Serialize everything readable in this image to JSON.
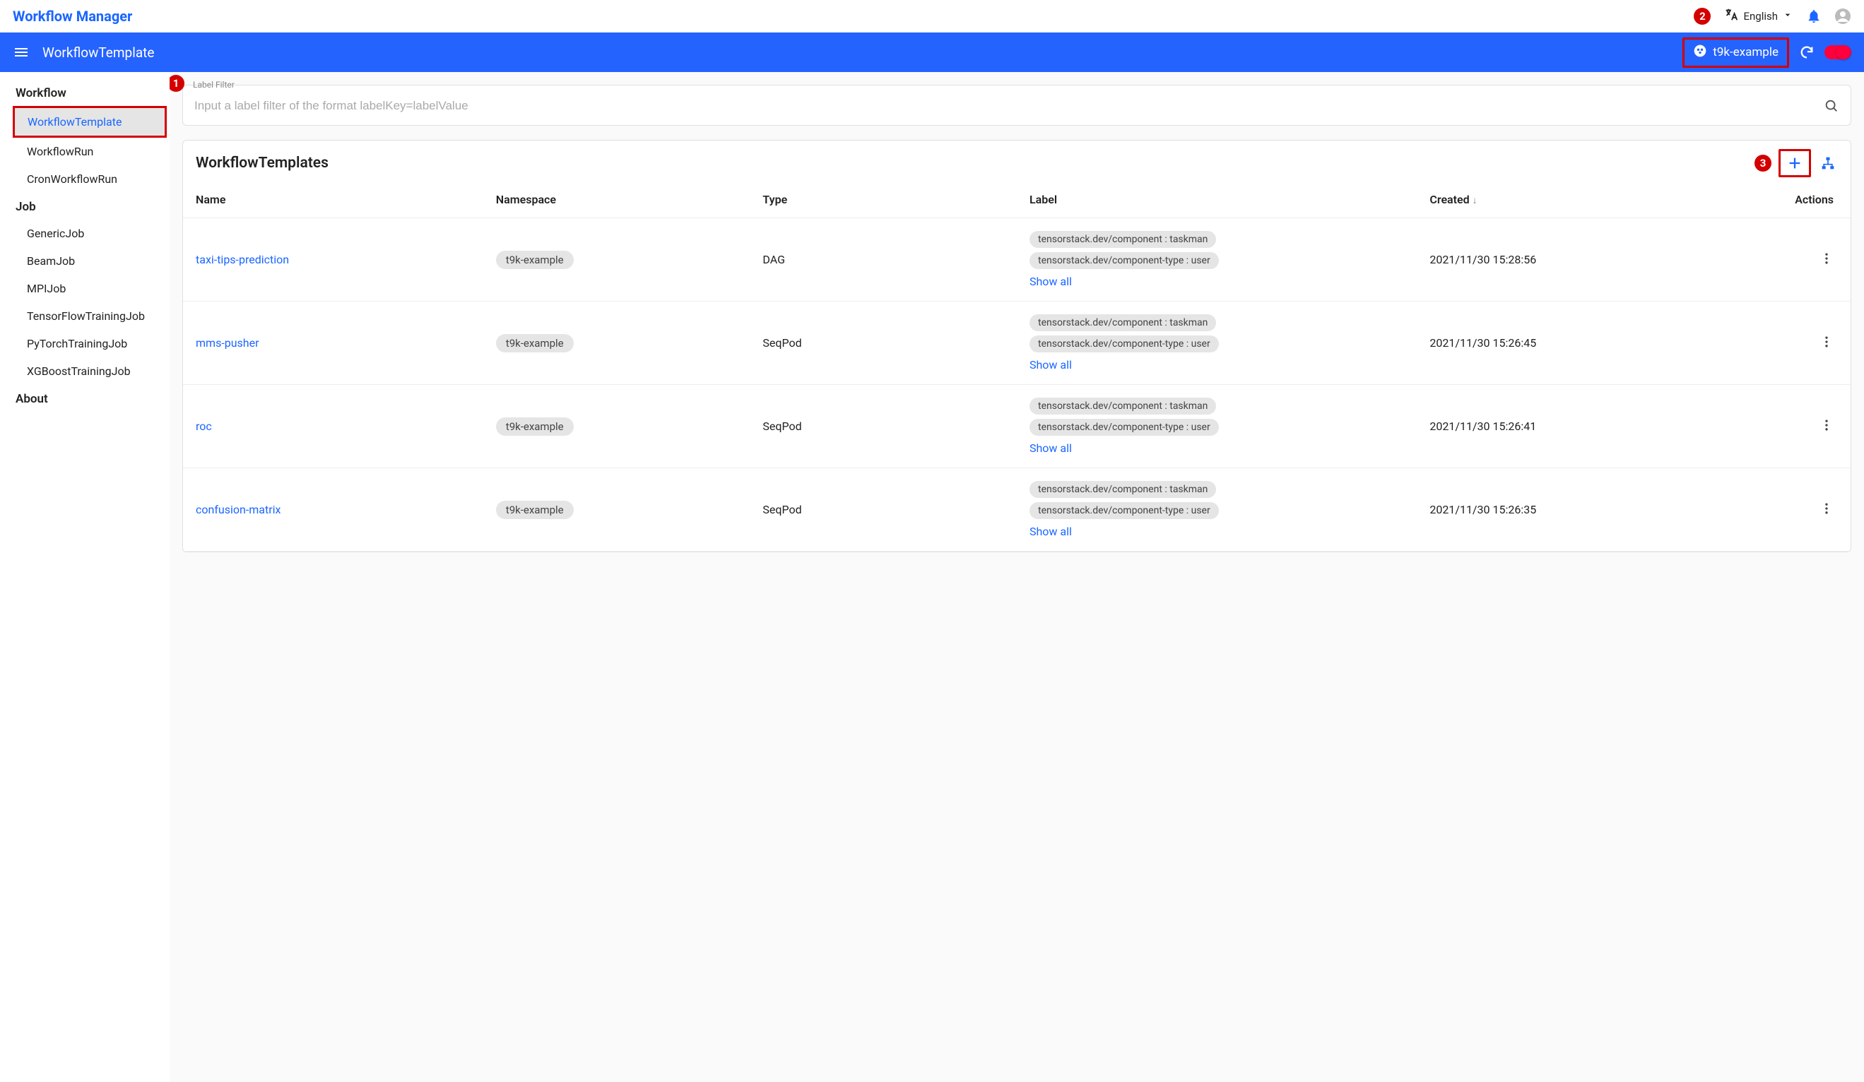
{
  "topbar": {
    "app_title": "Workflow Manager",
    "language": "English"
  },
  "bluebar": {
    "title": "WorkflowTemplate",
    "project": "t9k-example"
  },
  "sidebar": {
    "sections": [
      {
        "title": "Workflow",
        "items": [
          {
            "label": "WorkflowTemplate",
            "active": true
          },
          {
            "label": "WorkflowRun",
            "active": false
          },
          {
            "label": "CronWorkflowRun",
            "active": false
          }
        ]
      },
      {
        "title": "Job",
        "items": [
          {
            "label": "GenericJob",
            "active": false
          },
          {
            "label": "BeamJob",
            "active": false
          },
          {
            "label": "MPIJob",
            "active": false
          },
          {
            "label": "TensorFlowTrainingJob",
            "active": false
          },
          {
            "label": "PyTorchTrainingJob",
            "active": false
          },
          {
            "label": "XGBoostTrainingJob",
            "active": false
          }
        ]
      },
      {
        "title": "About",
        "items": []
      }
    ]
  },
  "filter": {
    "label": "Label Filter",
    "placeholder": "Input a label filter of the format labelKey=labelValue"
  },
  "table": {
    "title": "WorkflowTemplates",
    "columns": {
      "name": "Name",
      "namespace": "Namespace",
      "type": "Type",
      "label": "Label",
      "created": "Created",
      "actions": "Actions"
    },
    "show_all": "Show all",
    "rows": [
      {
        "name": "taxi-tips-prediction",
        "namespace": "t9k-example",
        "type": "DAG",
        "labels": [
          "tensorstack.dev/component : taskman",
          "tensorstack.dev/component-type : user"
        ],
        "created": "2021/11/30 15:28:56"
      },
      {
        "name": "mms-pusher",
        "namespace": "t9k-example",
        "type": "SeqPod",
        "labels": [
          "tensorstack.dev/component : taskman",
          "tensorstack.dev/component-type : user"
        ],
        "created": "2021/11/30 15:26:45"
      },
      {
        "name": "roc",
        "namespace": "t9k-example",
        "type": "SeqPod",
        "labels": [
          "tensorstack.dev/component : taskman",
          "tensorstack.dev/component-type : user"
        ],
        "created": "2021/11/30 15:26:41"
      },
      {
        "name": "confusion-matrix",
        "namespace": "t9k-example",
        "type": "SeqPod",
        "labels": [
          "tensorstack.dev/component : taskman",
          "tensorstack.dev/component-type : user"
        ],
        "created": "2021/11/30 15:26:35"
      }
    ]
  },
  "callouts": {
    "one": "1",
    "two": "2",
    "three": "3"
  }
}
